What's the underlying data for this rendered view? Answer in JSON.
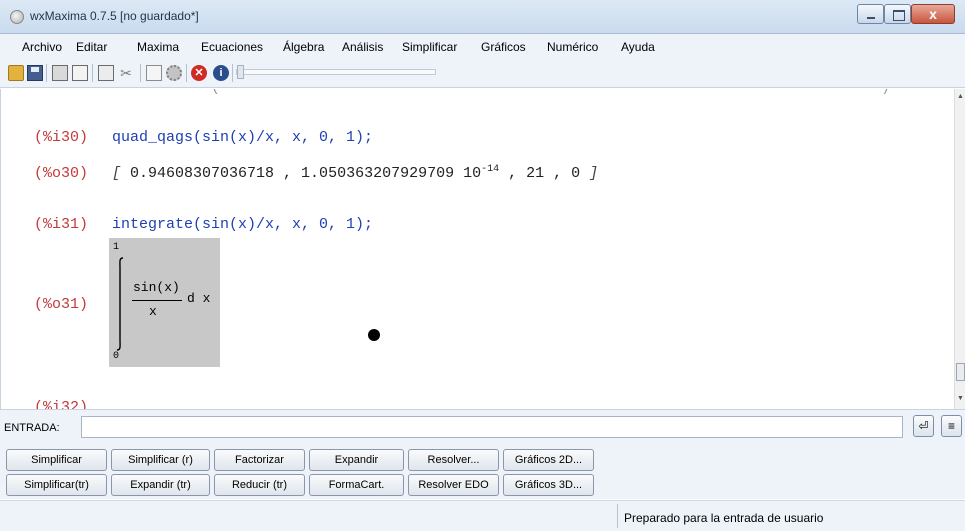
{
  "window": {
    "title": "wxMaxima 0.7.5 [no guardado*]",
    "close_glyph": "x"
  },
  "menu": [
    "Archivo",
    "Editar",
    "Maxima",
    "Ecuaciones",
    "Álgebra",
    "Análisis",
    "Simplificar",
    "Gráficos",
    "Numérico",
    "Ayuda"
  ],
  "toolbar": {
    "icons": [
      "open-icon",
      "save-icon",
      "print-icon",
      "properties-icon",
      "copy-icon",
      "cut-icon",
      "document-icon",
      "gear-icon",
      "stop-icon",
      "info-icon"
    ],
    "cut_glyph": "✂",
    "stop_glyph": "✕",
    "info_glyph": "i",
    "slider_level": 0
  },
  "worksheet": {
    "cells": [
      {
        "in_label": "(%i30)",
        "input": "quad_qags(sin(x)/x, x, 0, 1);",
        "out_label": "(%o30)",
        "out_open": "[",
        "out_values": "0.94608307036718 , 1.050363207929709 10",
        "out_exponent": "-14",
        "out_tail": ", 21 , 0",
        "out_close": "]"
      },
      {
        "in_label": "(%i31)",
        "input": "integrate(sin(x)/x, x, 0, 1);",
        "out_label": "(%o31)",
        "integral": {
          "upper": "1",
          "lower": "0",
          "numerator": "sin(x)",
          "denominator": "x",
          "differential": "d x"
        }
      },
      {
        "in_label": "(%i32)"
      }
    ],
    "remnant_left": "(",
    "remnant_right": ")"
  },
  "entrada": {
    "label": "ENTRADA:",
    "value": "",
    "enter_glyph": "⏎",
    "list_glyph": "≡"
  },
  "buttons": {
    "row1": [
      "Simplificar",
      "Simplificar (r)",
      "Factorizar",
      "Expandir",
      "Resolver...",
      "Gráficos 2D..."
    ],
    "row2": [
      "Simplificar(tr)",
      "Expandir (tr)",
      "Reducir (tr)",
      "FormaCart.",
      "Resolver EDO",
      "Gráficos 3D..."
    ]
  },
  "status": {
    "text": "Preparado para la entrada de usuario"
  },
  "scrollbar": {
    "up": "▲",
    "down": "▼"
  },
  "colors": {
    "label": "#c43a3a",
    "input": "#1f3fb4",
    "output": "#222222",
    "math_box": "#c8c8c8"
  }
}
